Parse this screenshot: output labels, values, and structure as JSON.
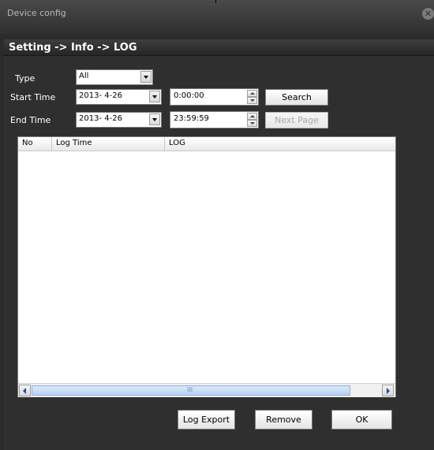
{
  "window": {
    "title": "Device config",
    "close_glyph": "✕"
  },
  "breadcrumb": "Setting -> Info -> LOG",
  "form": {
    "type_label": "Type",
    "type_value": "All",
    "start_time_label": "Start Time",
    "start_date": "2013- 4-26",
    "start_time": "0:00:00",
    "end_time_label": "End Time",
    "end_date": "2013- 4-26",
    "end_time": "23:59:59"
  },
  "buttons": {
    "search": "Search",
    "next_page": "Next Page",
    "log_export": "Log Export",
    "remove": "Remove",
    "ok": "OK"
  },
  "table": {
    "columns": [
      "No",
      "Log Time",
      "LOG"
    ],
    "rows": [],
    "scroll_grip": "III"
  },
  "colors": {
    "window_bg": "#2f2f2f",
    "title_text": "#b8b8b8",
    "label_text": "#ffffff",
    "scroll_thumb": "#b8d2f2"
  },
  "icons": {
    "close": "close-icon",
    "dropdown": "chevron-down-icon",
    "spin_up": "spin-up-icon",
    "spin_down": "spin-down-icon",
    "scroll_left": "arrow-left-icon",
    "scroll_right": "arrow-right-icon"
  }
}
